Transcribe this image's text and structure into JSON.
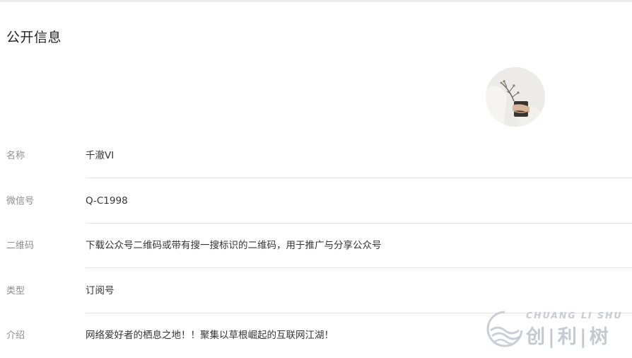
{
  "section": {
    "title": "公开信息"
  },
  "profile": {
    "avatar_icon": "plant-in-hand-photo"
  },
  "rows": [
    {
      "label": "名称",
      "value": "千澈VI"
    },
    {
      "label": "微信号",
      "value": "Q-C1998"
    },
    {
      "label": "二维码",
      "value": "下载公众号二维码或带有搜一搜标识的二维码，用于推广与分享公众号"
    },
    {
      "label": "类型",
      "value": "订阅号"
    },
    {
      "label": "介绍",
      "value": "网络爱好者的栖息之地！！聚集以草根崛起的互联网江湖！"
    }
  ],
  "watermark": {
    "latin": "CHUANG LI SHU",
    "chinese": "创|利|树",
    "icon": "wave-circle-logo-icon"
  },
  "colors": {
    "title": "#222222",
    "label": "#8d8d8d",
    "value": "#353535",
    "divider": "#e4e4e4",
    "watermark": "#c0c5cc"
  }
}
